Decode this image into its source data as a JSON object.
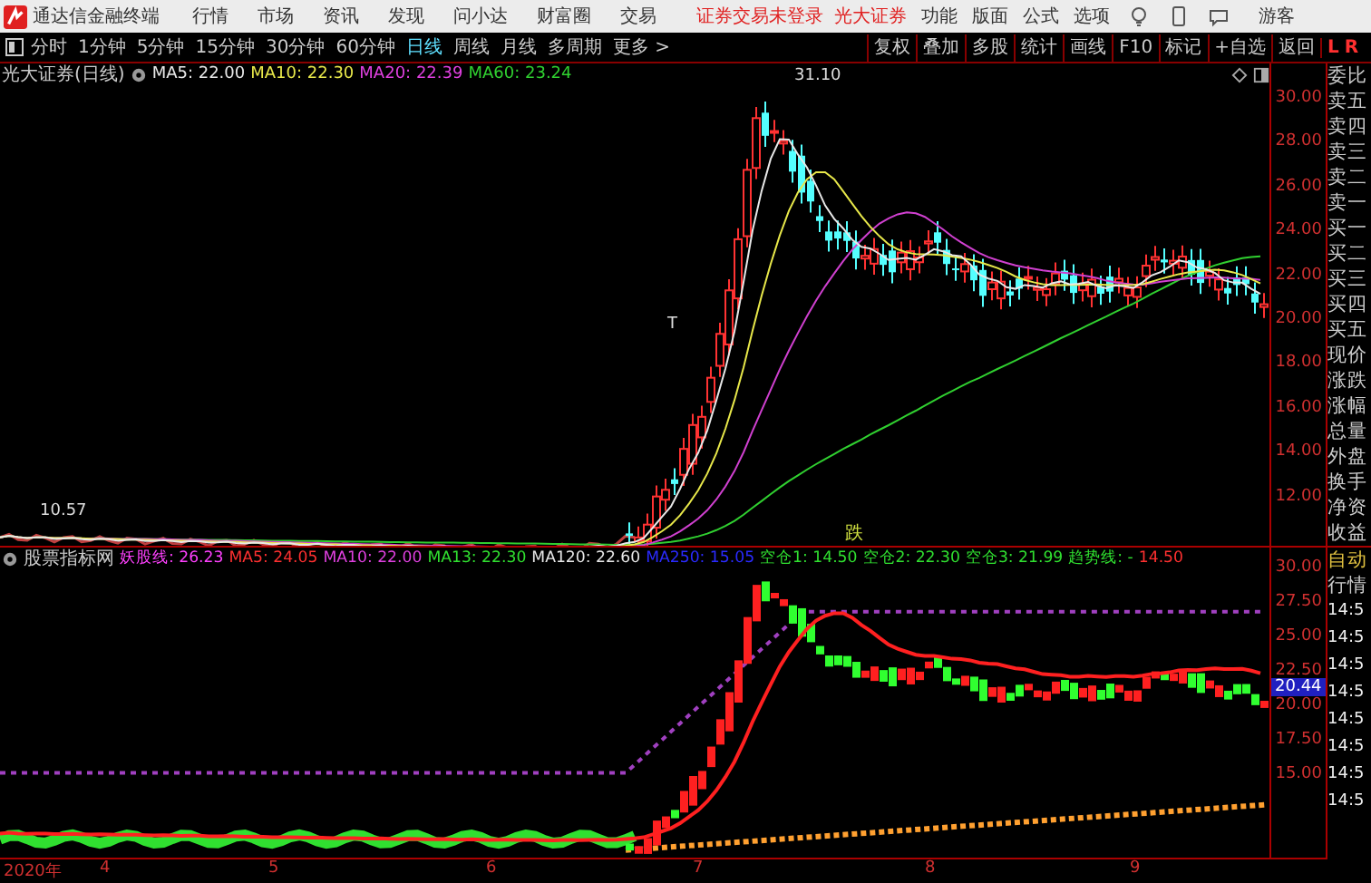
{
  "app": {
    "title": "通达信金融终端",
    "menu": [
      "行情",
      "市场",
      "资讯",
      "发现",
      "问小达",
      "财富圈",
      "交易"
    ],
    "login_status": "证券交易未登录",
    "broker": "光大证券",
    "tools": [
      "功能",
      "版面",
      "公式",
      "选项"
    ],
    "user": "游客"
  },
  "toolbar": {
    "periods": [
      {
        "label": "分时",
        "selected": false
      },
      {
        "label": "1分钟",
        "selected": false
      },
      {
        "label": "5分钟",
        "selected": false
      },
      {
        "label": "15分钟",
        "selected": false
      },
      {
        "label": "30分钟",
        "selected": false
      },
      {
        "label": "60分钟",
        "selected": false
      },
      {
        "label": "日线",
        "selected": true
      },
      {
        "label": "周线",
        "selected": false
      },
      {
        "label": "月线",
        "selected": false
      },
      {
        "label": "多周期",
        "selected": false
      },
      {
        "label": "更多 >",
        "selected": false
      }
    ],
    "actions": [
      "复权",
      "叠加",
      "多股",
      "统计",
      "画线",
      "F10",
      "标记",
      "+自选",
      "返回"
    ],
    "markers": [
      "L",
      "R"
    ]
  },
  "main_chart": {
    "title": "光大证券(日线)",
    "indicators": [
      {
        "label": "MA5: 22.00",
        "color": "#e8e8e8"
      },
      {
        "label": "MA10: 22.30",
        "color": "#e8e84a"
      },
      {
        "label": "MA20: 22.39",
        "color": "#e040e0"
      },
      {
        "label": "MA60: 23.24",
        "color": "#30d030"
      }
    ],
    "price_ticks": [
      "30.00",
      "28.00",
      "26.00",
      "24.00",
      "22.00",
      "20.00",
      "18.00",
      "16.00",
      "14.00",
      "12.00"
    ],
    "high_label": "31.10",
    "low_label": "10.57",
    "mark": "T",
    "signal": "跌"
  },
  "indicator_chart": {
    "title": "股票指标网",
    "indicators": [
      {
        "label": "妖股线: 26.23",
        "color": "#ff40ff"
      },
      {
        "label": "MA5: 24.05",
        "color": "#ff3030"
      },
      {
        "label": "MA10: 22.00",
        "color": "#e040e0"
      },
      {
        "label": "MA13: 22.30",
        "color": "#30e030"
      },
      {
        "label": "MA120: 22.60",
        "color": "#e8e8e8"
      },
      {
        "label": "MA250: 15.05",
        "color": "#2a2aff"
      },
      {
        "label": "空仓1: 14.50",
        "color": "#30e030"
      },
      {
        "label": "空仓2: 22.30",
        "color": "#30e030"
      },
      {
        "label": "空仓3: 21.99",
        "color": "#30e030"
      },
      {
        "label": "趋势线: -",
        "color": "#30e030"
      },
      {
        "label": "14.50",
        "color": "#ff3030"
      }
    ],
    "ticks": [
      "30.00",
      "27.50",
      "25.00",
      "22.50",
      "20.00",
      "17.50",
      "15.00"
    ],
    "current_value": "20.44"
  },
  "date_axis": [
    "2020年",
    "4",
    "5",
    "6",
    "7",
    "8",
    "9"
  ],
  "quote_panel": {
    "labels": [
      "委比",
      "卖五",
      "卖四",
      "卖三",
      "卖二",
      "卖一",
      "买一",
      "买二",
      "买三",
      "买四",
      "买五",
      "现价",
      "涨跌",
      "涨幅",
      "总量",
      "外盘",
      "换手",
      "净资",
      "收益"
    ],
    "mode": "自动",
    "tab": "行情",
    "times": [
      "14:5",
      "14:5",
      "14:5",
      "14:5",
      "14:5",
      "14:5",
      "14:5",
      "14:5"
    ]
  }
}
